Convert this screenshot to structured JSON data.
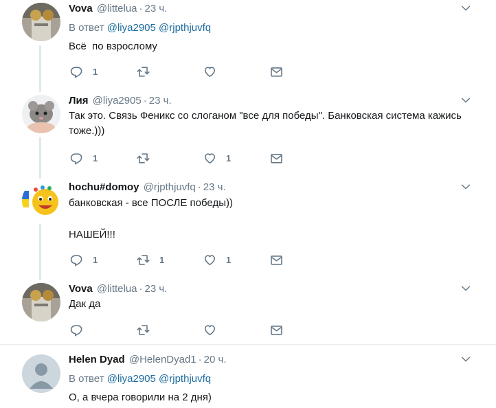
{
  "reply_prefix": "В ответ",
  "tweets": [
    {
      "fullname": "Vova",
      "username": "@littelua",
      "time": "23 ч.",
      "reply_to": [
        "@liya2905",
        "@rjpthjuvfq"
      ],
      "text": "Всё  по взрослому",
      "replies": "1",
      "retweets": "",
      "likes": ""
    },
    {
      "fullname": "Лия",
      "username": "@liya2905",
      "time": "23 ч.",
      "text": "Так это. Связь Феникс со слоганом \"все для победы\". Банковская система кажись тоже.)))",
      "replies": "1",
      "retweets": "",
      "likes": "1"
    },
    {
      "fullname": "hochu#domoy",
      "username": "@rjpthjuvfq",
      "time": "23 ч.",
      "text": "банковская - все ПОСЛЕ победы))\n\nНАШЕЙ!!!",
      "replies": "1",
      "retweets": "1",
      "likes": "1"
    },
    {
      "fullname": "Vova",
      "username": "@littelua",
      "time": "23 ч.",
      "text": "Дак да",
      "replies": "",
      "retweets": "",
      "likes": ""
    },
    {
      "fullname": "Helen Dyad",
      "username": "@HelenDyad1",
      "time": "20 ч.",
      "reply_to": [
        "@liya2905",
        "@rjpthjuvfq"
      ],
      "text": "О, а вчера говорили на 2 дня)"
    }
  ]
}
